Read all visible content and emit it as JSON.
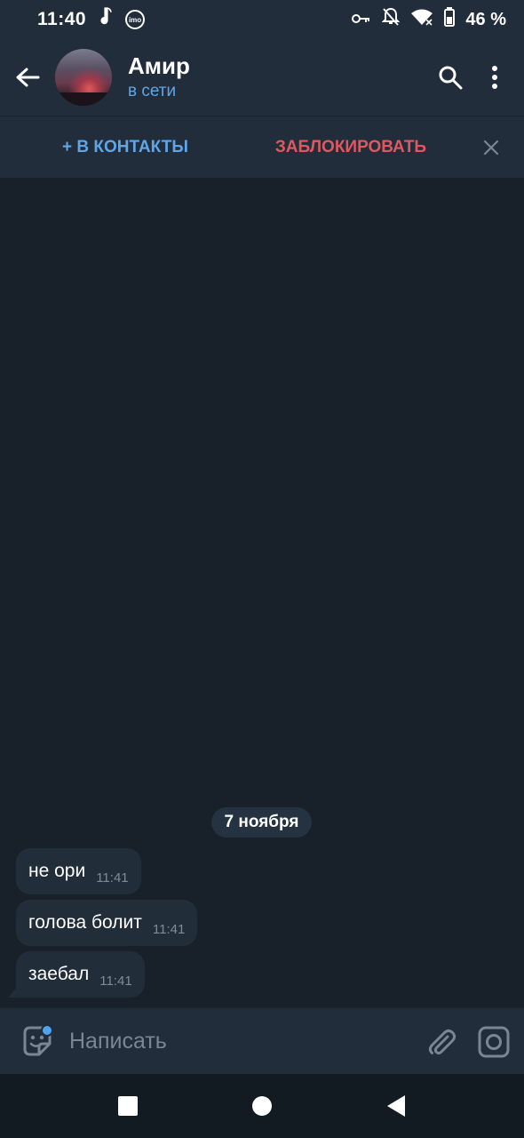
{
  "status_bar": {
    "time": "11:40",
    "imo_label": "imo",
    "battery_text": "46 %"
  },
  "header": {
    "peer_name": "Амир",
    "peer_status": "в сети"
  },
  "action_bar": {
    "add_contact_label": "+ В КОНТАКТЫ",
    "block_label": "ЗАБЛОКИРОВАТЬ"
  },
  "chat": {
    "date_label": "7 ноября",
    "messages": [
      {
        "text": "не ори",
        "time": "11:41"
      },
      {
        "text": "голова болит",
        "time": "11:41"
      },
      {
        "text": "заебал",
        "time": "11:41"
      }
    ]
  },
  "composer": {
    "placeholder": "Написать"
  },
  "colors": {
    "accent": "#5fa6e8",
    "danger": "#e1575e",
    "bar_background": "#212d3b",
    "chat_background": "#18202a",
    "bubble": "#222d3a"
  }
}
